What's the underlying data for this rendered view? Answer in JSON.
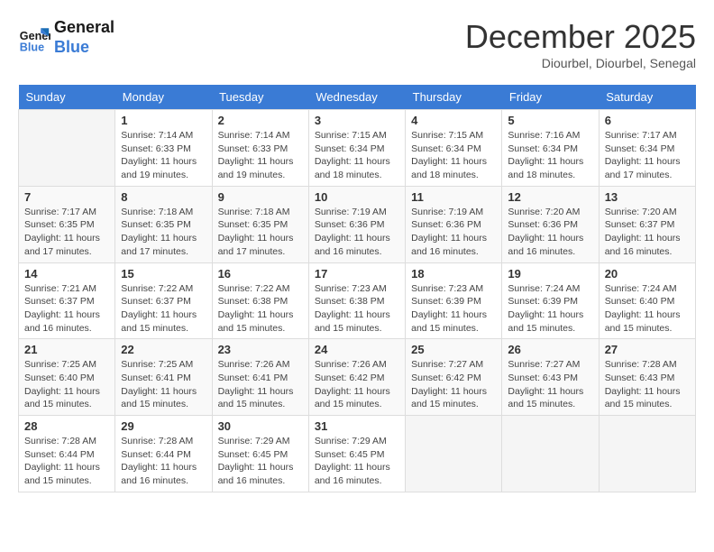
{
  "logo": {
    "line1": "General",
    "line2": "Blue"
  },
  "header": {
    "month": "December 2025",
    "location": "Diourbel, Diourbel, Senegal"
  },
  "days_of_week": [
    "Sunday",
    "Monday",
    "Tuesday",
    "Wednesday",
    "Thursday",
    "Friday",
    "Saturday"
  ],
  "weeks": [
    [
      {
        "day": "",
        "info": ""
      },
      {
        "day": "1",
        "info": "Sunrise: 7:14 AM\nSunset: 6:33 PM\nDaylight: 11 hours\nand 19 minutes."
      },
      {
        "day": "2",
        "info": "Sunrise: 7:14 AM\nSunset: 6:33 PM\nDaylight: 11 hours\nand 19 minutes."
      },
      {
        "day": "3",
        "info": "Sunrise: 7:15 AM\nSunset: 6:34 PM\nDaylight: 11 hours\nand 18 minutes."
      },
      {
        "day": "4",
        "info": "Sunrise: 7:15 AM\nSunset: 6:34 PM\nDaylight: 11 hours\nand 18 minutes."
      },
      {
        "day": "5",
        "info": "Sunrise: 7:16 AM\nSunset: 6:34 PM\nDaylight: 11 hours\nand 18 minutes."
      },
      {
        "day": "6",
        "info": "Sunrise: 7:17 AM\nSunset: 6:34 PM\nDaylight: 11 hours\nand 17 minutes."
      }
    ],
    [
      {
        "day": "7",
        "info": "Sunrise: 7:17 AM\nSunset: 6:35 PM\nDaylight: 11 hours\nand 17 minutes."
      },
      {
        "day": "8",
        "info": "Sunrise: 7:18 AM\nSunset: 6:35 PM\nDaylight: 11 hours\nand 17 minutes."
      },
      {
        "day": "9",
        "info": "Sunrise: 7:18 AM\nSunset: 6:35 PM\nDaylight: 11 hours\nand 17 minutes."
      },
      {
        "day": "10",
        "info": "Sunrise: 7:19 AM\nSunset: 6:36 PM\nDaylight: 11 hours\nand 16 minutes."
      },
      {
        "day": "11",
        "info": "Sunrise: 7:19 AM\nSunset: 6:36 PM\nDaylight: 11 hours\nand 16 minutes."
      },
      {
        "day": "12",
        "info": "Sunrise: 7:20 AM\nSunset: 6:36 PM\nDaylight: 11 hours\nand 16 minutes."
      },
      {
        "day": "13",
        "info": "Sunrise: 7:20 AM\nSunset: 6:37 PM\nDaylight: 11 hours\nand 16 minutes."
      }
    ],
    [
      {
        "day": "14",
        "info": "Sunrise: 7:21 AM\nSunset: 6:37 PM\nDaylight: 11 hours\nand 16 minutes."
      },
      {
        "day": "15",
        "info": "Sunrise: 7:22 AM\nSunset: 6:37 PM\nDaylight: 11 hours\nand 15 minutes."
      },
      {
        "day": "16",
        "info": "Sunrise: 7:22 AM\nSunset: 6:38 PM\nDaylight: 11 hours\nand 15 minutes."
      },
      {
        "day": "17",
        "info": "Sunrise: 7:23 AM\nSunset: 6:38 PM\nDaylight: 11 hours\nand 15 minutes."
      },
      {
        "day": "18",
        "info": "Sunrise: 7:23 AM\nSunset: 6:39 PM\nDaylight: 11 hours\nand 15 minutes."
      },
      {
        "day": "19",
        "info": "Sunrise: 7:24 AM\nSunset: 6:39 PM\nDaylight: 11 hours\nand 15 minutes."
      },
      {
        "day": "20",
        "info": "Sunrise: 7:24 AM\nSunset: 6:40 PM\nDaylight: 11 hours\nand 15 minutes."
      }
    ],
    [
      {
        "day": "21",
        "info": "Sunrise: 7:25 AM\nSunset: 6:40 PM\nDaylight: 11 hours\nand 15 minutes."
      },
      {
        "day": "22",
        "info": "Sunrise: 7:25 AM\nSunset: 6:41 PM\nDaylight: 11 hours\nand 15 minutes."
      },
      {
        "day": "23",
        "info": "Sunrise: 7:26 AM\nSunset: 6:41 PM\nDaylight: 11 hours\nand 15 minutes."
      },
      {
        "day": "24",
        "info": "Sunrise: 7:26 AM\nSunset: 6:42 PM\nDaylight: 11 hours\nand 15 minutes."
      },
      {
        "day": "25",
        "info": "Sunrise: 7:27 AM\nSunset: 6:42 PM\nDaylight: 11 hours\nand 15 minutes."
      },
      {
        "day": "26",
        "info": "Sunrise: 7:27 AM\nSunset: 6:43 PM\nDaylight: 11 hours\nand 15 minutes."
      },
      {
        "day": "27",
        "info": "Sunrise: 7:28 AM\nSunset: 6:43 PM\nDaylight: 11 hours\nand 15 minutes."
      }
    ],
    [
      {
        "day": "28",
        "info": "Sunrise: 7:28 AM\nSunset: 6:44 PM\nDaylight: 11 hours\nand 15 minutes."
      },
      {
        "day": "29",
        "info": "Sunrise: 7:28 AM\nSunset: 6:44 PM\nDaylight: 11 hours\nand 16 minutes."
      },
      {
        "day": "30",
        "info": "Sunrise: 7:29 AM\nSunset: 6:45 PM\nDaylight: 11 hours\nand 16 minutes."
      },
      {
        "day": "31",
        "info": "Sunrise: 7:29 AM\nSunset: 6:45 PM\nDaylight: 11 hours\nand 16 minutes."
      },
      {
        "day": "",
        "info": ""
      },
      {
        "day": "",
        "info": ""
      },
      {
        "day": "",
        "info": ""
      }
    ]
  ]
}
